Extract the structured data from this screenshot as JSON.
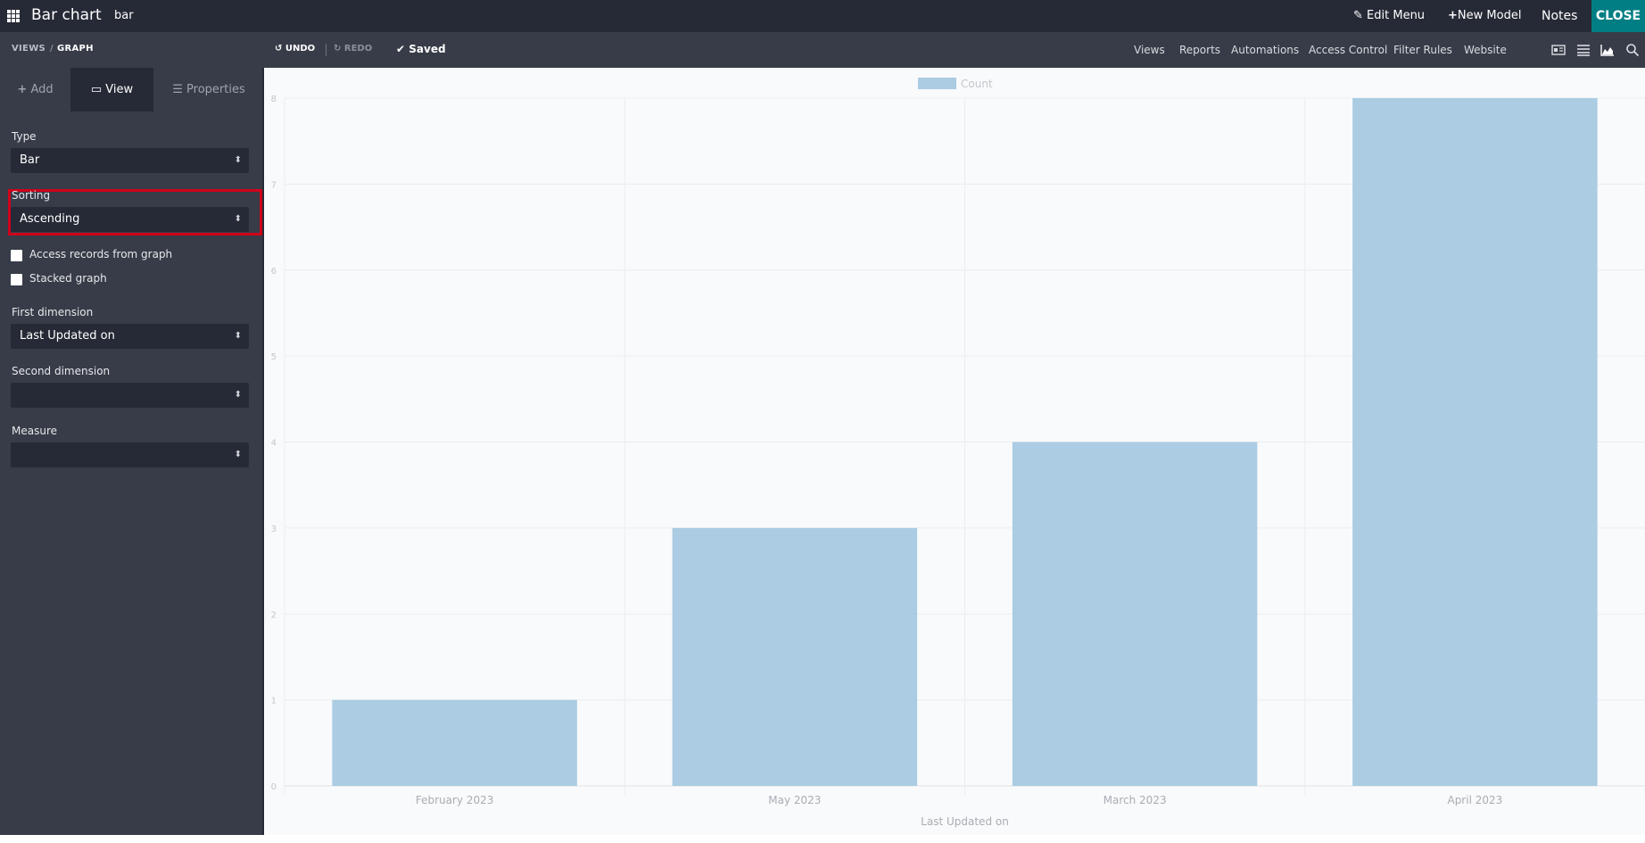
{
  "topbar": {
    "title": "Bar chart",
    "model": "bar",
    "edit_menu": "Edit Menu",
    "new_model": "New Model",
    "notes": "Notes",
    "close": "CLOSE"
  },
  "subbar": {
    "crumb_views": "VIEWS",
    "crumb_graph": "GRAPH",
    "undo": "UNDO",
    "redo": "REDO",
    "saved": "Saved",
    "nav": {
      "views": "Views",
      "reports": "Reports",
      "automations": "Automations",
      "access_control": "Access Control",
      "filter_rules": "Filter Rules",
      "website": "Website"
    },
    "view_icons": [
      "form-view-icon",
      "list-view-icon",
      "graph-view-icon",
      "search-icon"
    ]
  },
  "sidebar": {
    "tabs": {
      "add": "Add",
      "view": "View",
      "properties": "Properties"
    },
    "type_label": "Type",
    "type_value": "Bar",
    "sorting_label": "Sorting",
    "sorting_value": "Ascending",
    "access_records_label": "Access records from graph",
    "access_records_checked": false,
    "stacked_label": "Stacked graph",
    "stacked_checked": false,
    "first_dim_label": "First dimension",
    "first_dim_value": "Last Updated on",
    "second_dim_label": "Second dimension",
    "second_dim_value": "",
    "measure_label": "Measure",
    "measure_value": ""
  },
  "colors": {
    "accent": "#017e84",
    "bar": "#abcce3",
    "highlight": "#d0021b"
  },
  "chart_data": {
    "type": "bar",
    "categories": [
      "February 2023",
      "May 2023",
      "March 2023",
      "April 2023"
    ],
    "series": [
      {
        "name": "Count",
        "values": [
          1,
          3,
          4,
          8
        ]
      }
    ],
    "xlabel": "Last Updated on",
    "ylabel": "",
    "ylim": [
      0,
      8
    ],
    "yticks": [
      "0",
      "1",
      "2",
      "3",
      "4",
      "5",
      "6",
      "7",
      "8"
    ],
    "legend": "top-center",
    "grid": true
  }
}
